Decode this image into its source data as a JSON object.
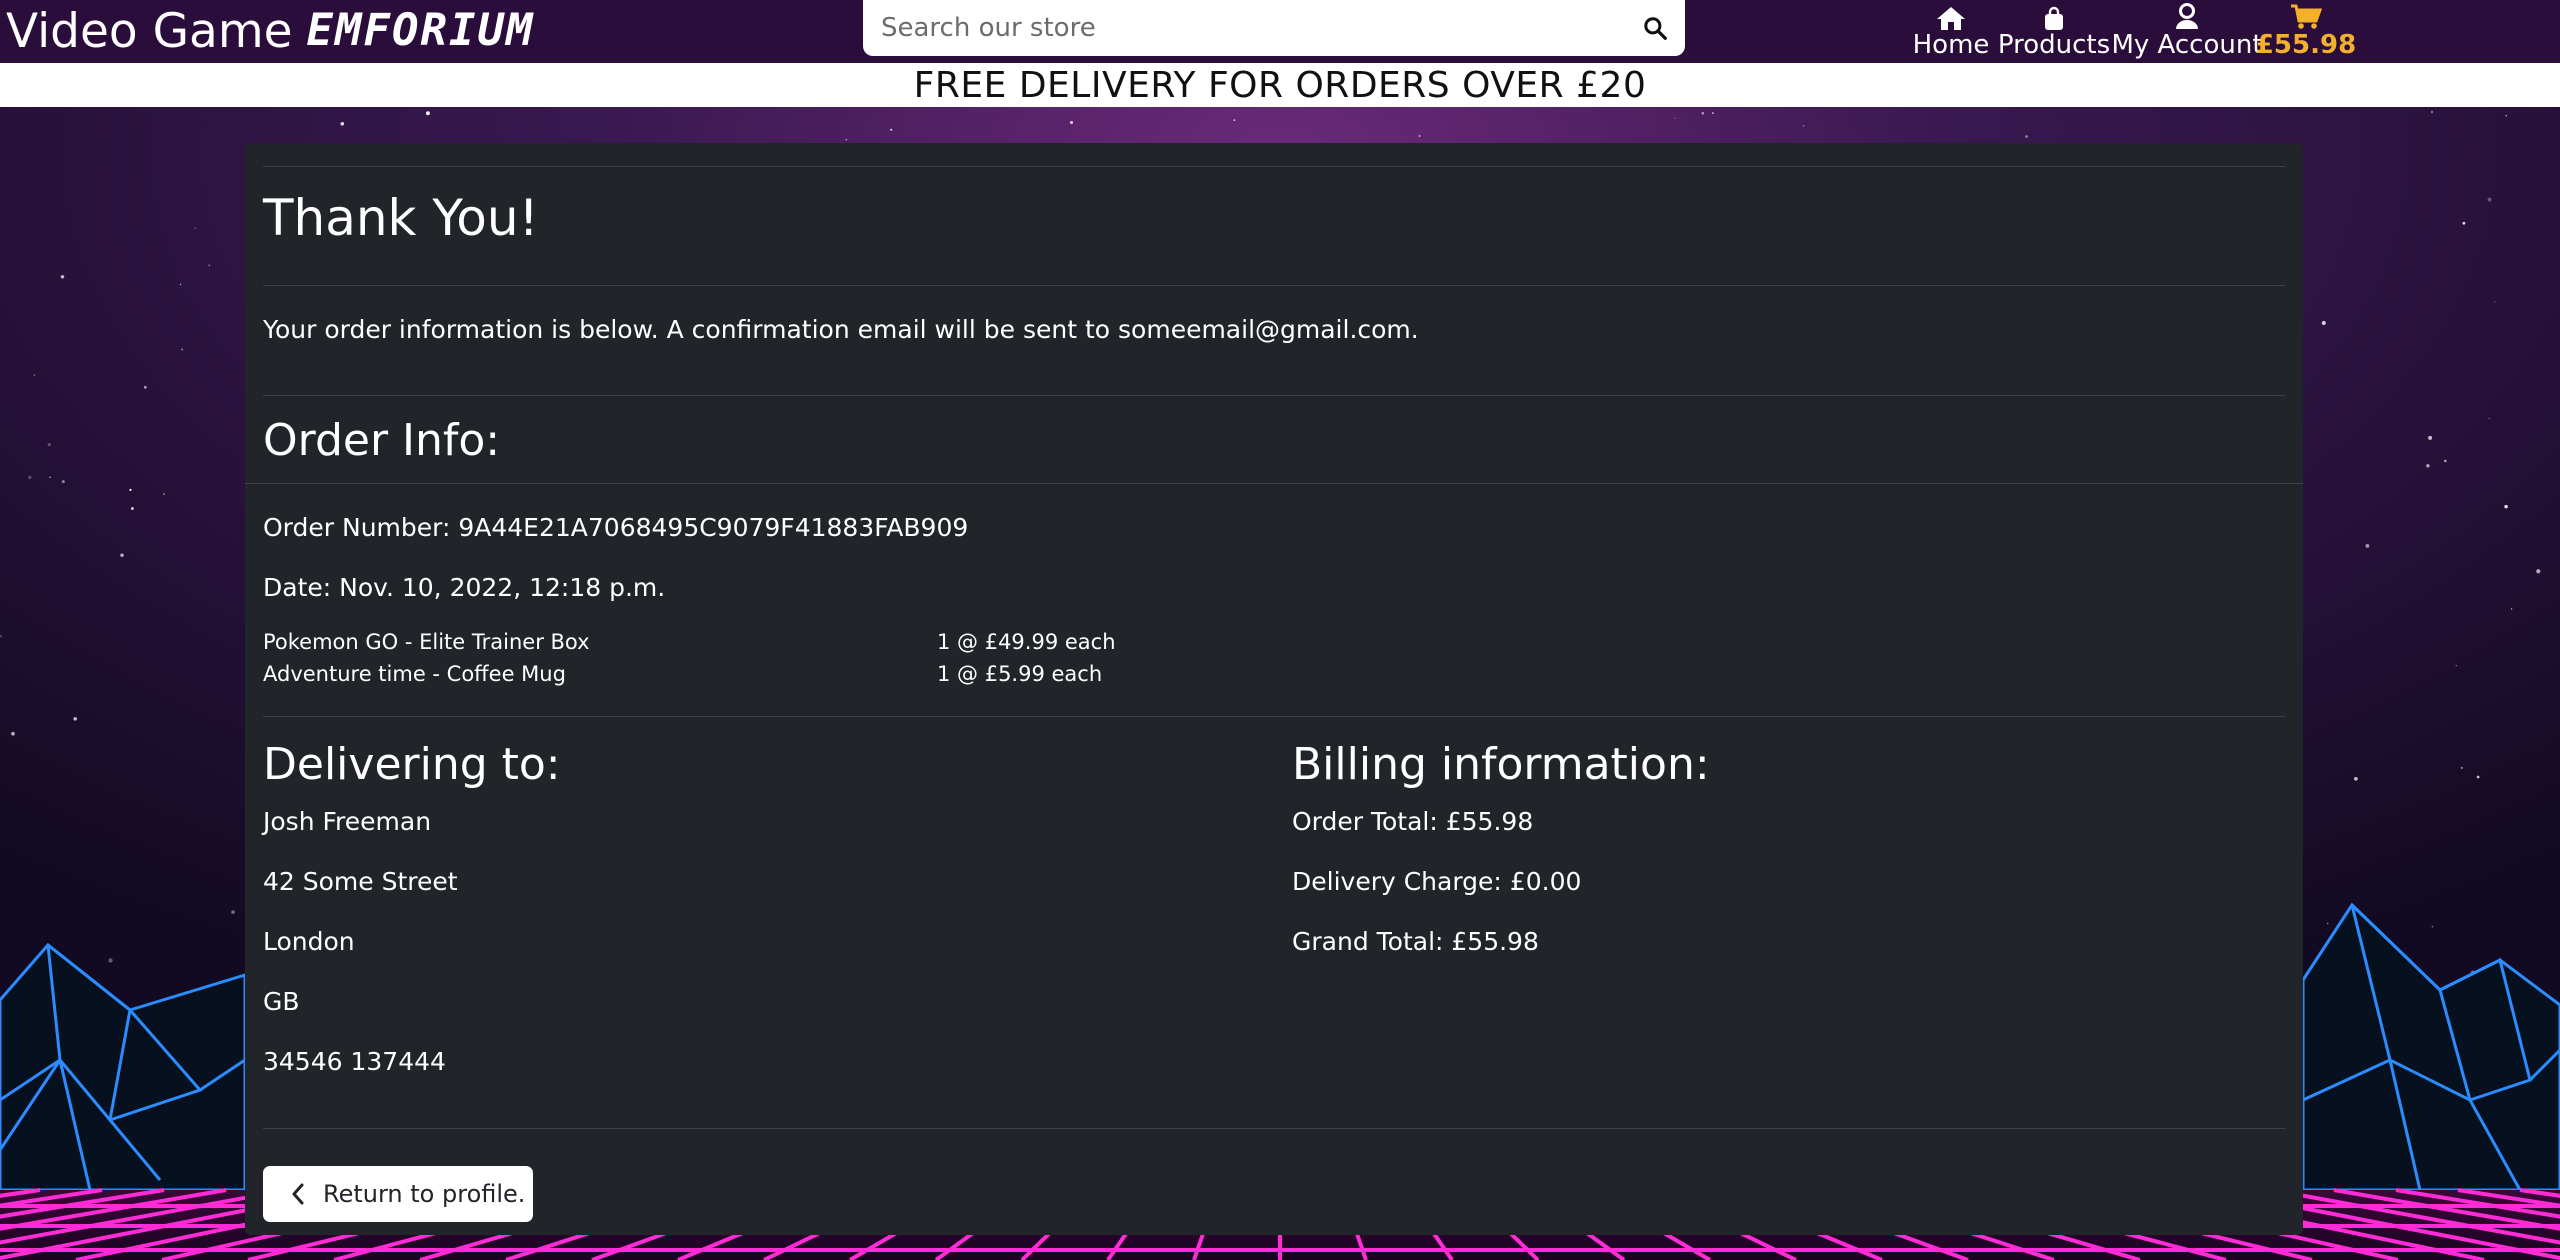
{
  "header": {
    "brand_main": "Video Game",
    "brand_accent": "EMFORIUM",
    "search_placeholder": "Search our store",
    "nav": [
      {
        "label": "Home",
        "icon": "home-icon"
      },
      {
        "label": "Products",
        "icon": "shopping-bag-icon"
      },
      {
        "label": "My Account",
        "icon": "user-icon"
      }
    ],
    "cart": {
      "label": "£55.98",
      "icon": "cart-icon"
    }
  },
  "banner": {
    "text": "FREE DELIVERY FOR ORDERS OVER £20"
  },
  "checkout": {
    "title": "Thank You!",
    "message_prefix": "Your order information is below. A confirmation email will be sent to ",
    "email": "someemail@gmail.com",
    "message_suffix": ".",
    "order_info_title": "Order Info:",
    "order_number_label": "Order Number: ",
    "order_number": "9A44E21A7068495C9079F41883FAB909",
    "date_label": "Date: ",
    "date": "Nov. 10, 2022, 12:18 p.m.",
    "items": [
      {
        "name": "Pokemon GO - Elite Trainer Box",
        "qty_price": "1 @ £49.99 each"
      },
      {
        "name": "Adventure time - Coffee Mug",
        "qty_price": "1 @ £5.99 each"
      }
    ],
    "delivering_title": "Delivering to:",
    "address": [
      "Josh Freeman",
      "42 Some Street",
      "London",
      "GB",
      "34546 137444"
    ],
    "billing_title": "Billing information:",
    "order_total_label": "Order Total: ",
    "order_total": "£55.98",
    "delivery_charge_label": "Delivery Charge: ",
    "delivery_charge": "£0.00",
    "grand_total_label": "Grand Total: ",
    "grand_total": "£55.98",
    "return_label": "Return to profile."
  },
  "colors": {
    "header_bg": "#2a0d3a",
    "card_bg": "#212428",
    "cart_accent": "#f4b02c",
    "grid_neon": "#ff2bd6",
    "mountain_neon": "#2b8cff"
  }
}
